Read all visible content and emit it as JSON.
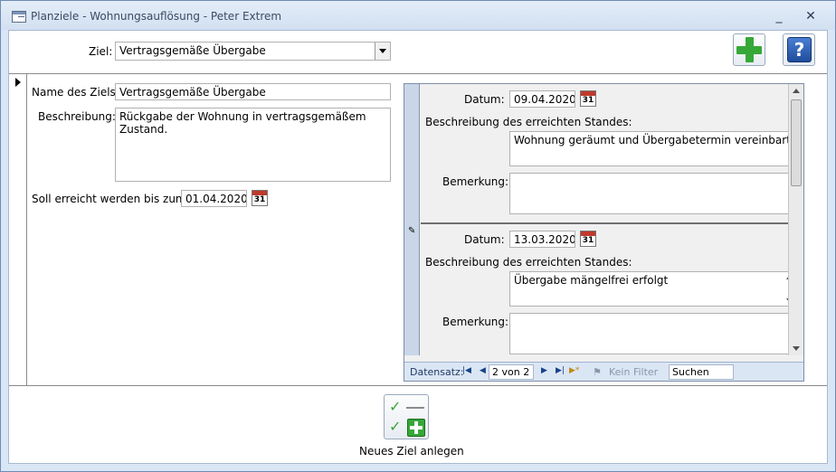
{
  "window": {
    "title": "Planziele - Wohnungsauflösung - Peter Extrem",
    "minimize_glyph": "_",
    "close_glyph": "✕"
  },
  "header": {
    "ziel_label": "Ziel:",
    "ziel_value": "Vertragsgemäße Übergabe",
    "add_icon": "plus-icon",
    "help_icon": "help-icon",
    "help_glyph": "?"
  },
  "goal": {
    "name_label": "Name des Ziels:",
    "name_value": "Vertragsgemäße Übergabe",
    "desc_label": "Beschreibung:",
    "desc_value": "Rückgabe der Wohnung in vertragsgemäßem Zustand.",
    "due_label": "Soll erreicht werden bis zum:",
    "due_value": "01.04.2020"
  },
  "calendar_icon": {
    "name": "calendar-icon",
    "day": "31"
  },
  "subform": {
    "records": [
      {
        "datum_label": "Datum:",
        "datum_value": "09.04.2020",
        "stand_label": "Beschreibung des erreichten Standes:",
        "stand_value": "Wohnung geräumt und Übergabetermin vereinbart",
        "bemerkung_label": "Bemerkung:",
        "bemerkung_value": ""
      },
      {
        "datum_label": "Datum:",
        "datum_value": "13.03.2020",
        "stand_label": "Beschreibung des erreichten Standes:",
        "stand_value": "Übergabe mängelfrei erfolgt",
        "bemerkung_label": "Bemerkung:",
        "bemerkung_value": ""
      }
    ],
    "nav": {
      "label": "Datensatz:",
      "first": "|◀",
      "prev": "◀",
      "current": "2 von 2",
      "next": "▶",
      "last": "▶|",
      "new": "▶*",
      "filter_label": "Kein Filter",
      "search_placeholder": "Suchen"
    }
  },
  "footer": {
    "new_goal_label": "Neues Ziel anlegen",
    "check_glyph": "✓"
  },
  "colors": {
    "accent_green": "#35a838",
    "help_blue": "#1f4c9c",
    "calendar_red": "#c0392b"
  }
}
